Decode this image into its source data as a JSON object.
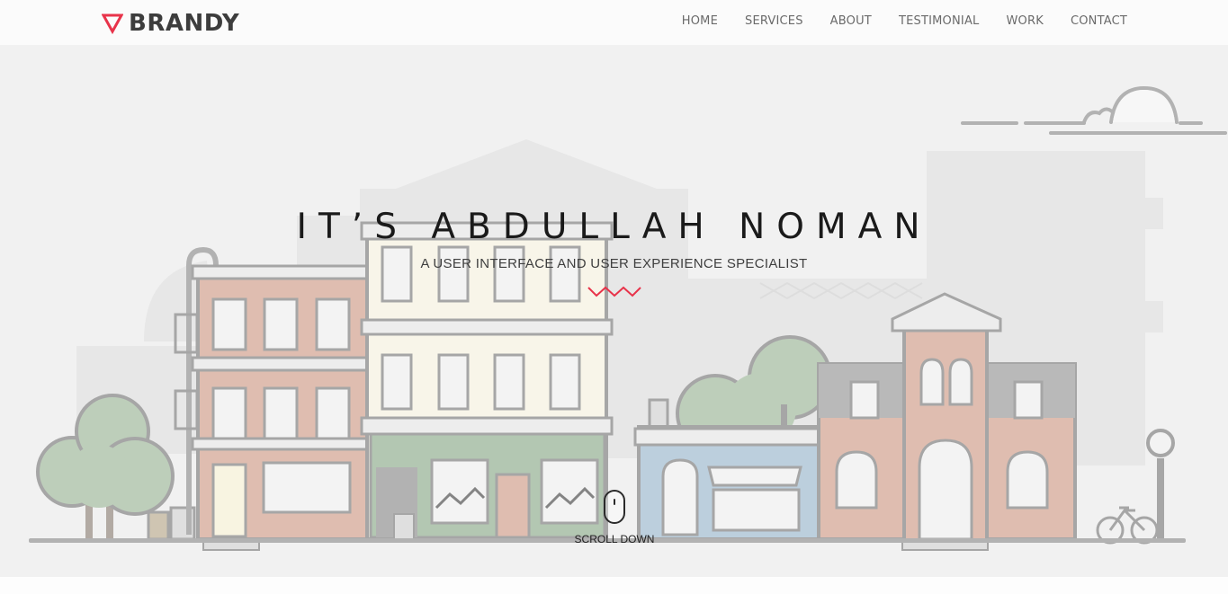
{
  "brand": {
    "name": "BRANDY",
    "logo_icon": "triangle-down-icon",
    "accent_color": "#e8334a"
  },
  "nav": {
    "items": [
      "HOME",
      "SERVICES",
      "ABOUT",
      "TESTIMONIAL",
      "WORK",
      "CONTACT"
    ]
  },
  "hero": {
    "title": "IT’S ABDULLAH NOMAN",
    "subtitle": "A USER INTERFACE AND USER EXPERIENCE SPECIALIST",
    "divider_icon": "zigzag-icon",
    "scroll_label": "SCROLL DOWN",
    "scroll_icon": "mouse-icon"
  }
}
